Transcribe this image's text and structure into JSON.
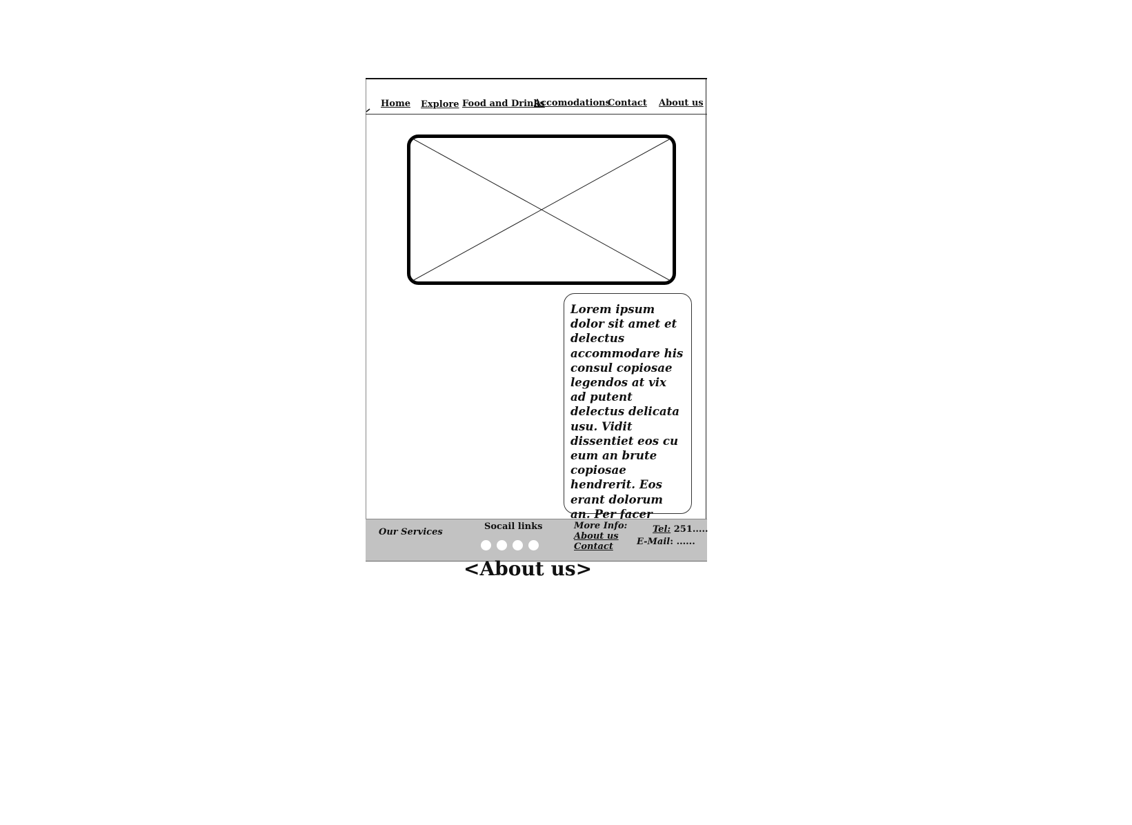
{
  "nav": {
    "items": [
      {
        "label": "Home"
      },
      {
        "label": "Explore"
      },
      {
        "label": "Food and Drinks"
      },
      {
        "label": "Accomodations"
      },
      {
        "label": "Contact"
      },
      {
        "label": "About us"
      }
    ]
  },
  "hero": {
    "icon": "image-placeholder-icon"
  },
  "content": {
    "paragraph": "Lorem ipsum dolor sit amet et delectus accommodare his consul copiosae legendos at vix ad putent delectus delicata usu. Vidit dissentiet eos cu eum an brute copiosae hendrerit. Eos erant dolorum an. Per facer affert ut. Mei iisque mentitum"
  },
  "footer": {
    "services_label": "Our Services",
    "social_label": "Socail links",
    "social_count": 4,
    "more_info_label": "More Info:",
    "about_link": "About us",
    "contact_link": "Contact",
    "tel_label": "Tel:",
    "tel_value": "251.....",
    "email_label": "E-Mail",
    "email_value": ": ......"
  },
  "caption": "<About us>",
  "colors": {
    "footer_bg": "#c2c2c2",
    "border": "#111111"
  }
}
